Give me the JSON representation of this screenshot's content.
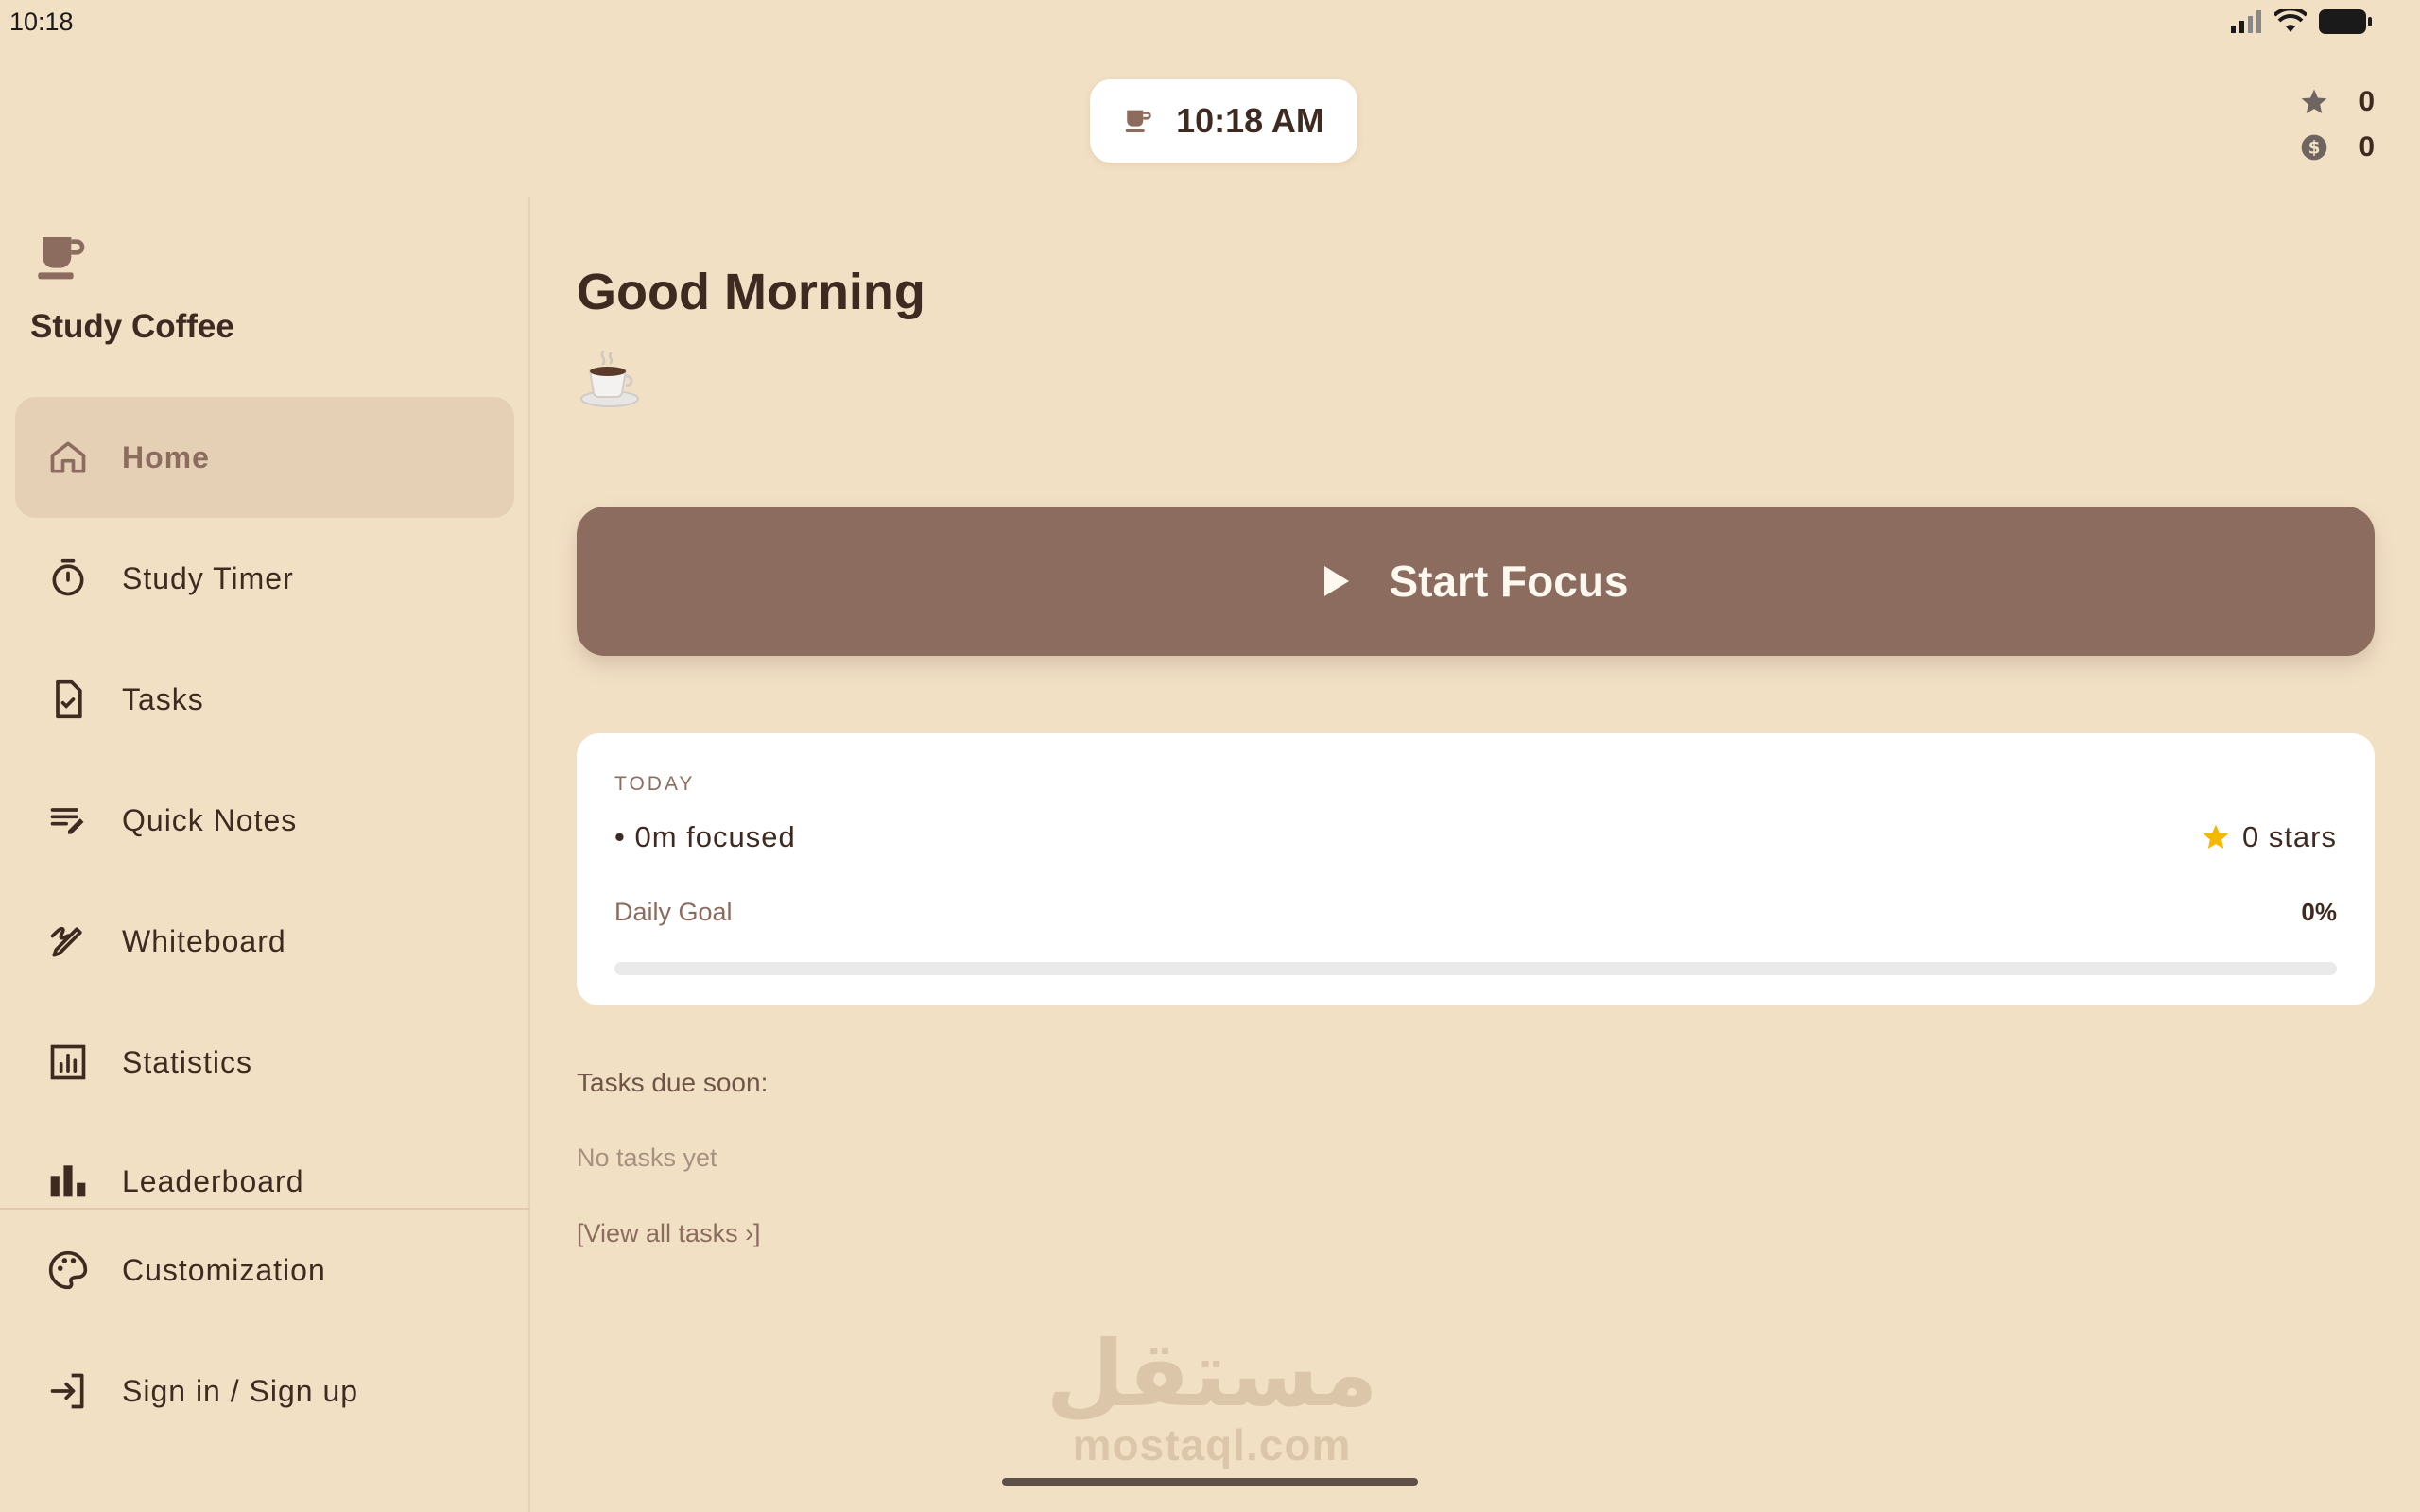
{
  "status_bar": {
    "time": "10:18"
  },
  "header": {
    "clock_label": "10:18 AM",
    "clock_icon": "coffee-cup-icon",
    "stars_count": "0",
    "coins_count": "0"
  },
  "sidebar": {
    "app_name": "Study Coffee",
    "items": [
      {
        "label": "Home",
        "icon": "home-icon",
        "active": true
      },
      {
        "label": "Study Timer",
        "icon": "stopwatch-icon"
      },
      {
        "label": "Tasks",
        "icon": "task-file-icon"
      },
      {
        "label": "Quick Notes",
        "icon": "notes-icon"
      },
      {
        "label": "Whiteboard",
        "icon": "whiteboard-icon"
      },
      {
        "label": "Statistics",
        "icon": "statistics-icon"
      },
      {
        "label": "Leaderboard",
        "icon": "leaderboard-icon"
      }
    ],
    "footer_items": [
      {
        "label": "Customization",
        "icon": "palette-icon"
      },
      {
        "label": "Sign in / Sign up",
        "icon": "sign-in-icon"
      }
    ]
  },
  "main": {
    "greeting": "Good Morning",
    "greeting_emoji": "☕",
    "focus_button_label": "Start Focus",
    "today": {
      "section_label": "TODAY",
      "focused_text": "• 0m focused",
      "stars_text": "0 stars",
      "daily_goal_label": "Daily Goal",
      "daily_goal_percent": "0%",
      "daily_goal_progress": 0
    },
    "tasks_due": {
      "title": "Tasks due soon:",
      "empty_text": "No tasks yet",
      "view_all_link": "[View all tasks ›]"
    }
  },
  "watermark": {
    "arabic": "مستقل",
    "latin": "mostaql.com"
  },
  "colors": {
    "background": "#F2E0C5",
    "accent": "#8B6C5F",
    "text_dark": "#3E2A20",
    "active_nav": "#E6D0B5",
    "star_yellow": "#F5B800"
  }
}
